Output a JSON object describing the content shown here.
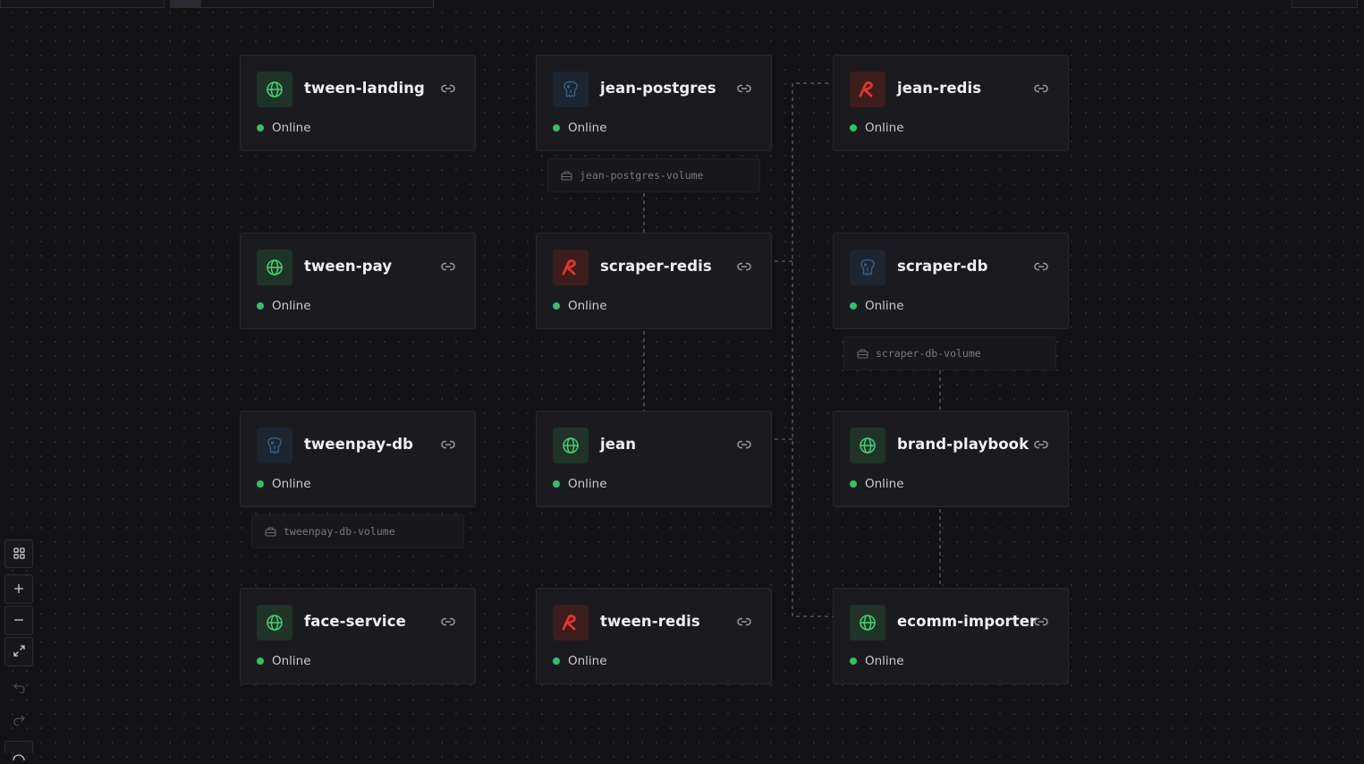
{
  "services": [
    {
      "name": "tween-landing",
      "type": "web",
      "status": "Online"
    },
    {
      "name": "jean-postgres",
      "type": "postgres",
      "status": "Online"
    },
    {
      "name": "jean-redis",
      "type": "redis",
      "status": "Online"
    },
    {
      "name": "tween-pay",
      "type": "web",
      "status": "Online"
    },
    {
      "name": "scraper-redis",
      "type": "redis",
      "status": "Online"
    },
    {
      "name": "scraper-db",
      "type": "postgres",
      "status": "Online"
    },
    {
      "name": "tweenpay-db",
      "type": "postgres",
      "status": "Online"
    },
    {
      "name": "jean",
      "type": "web",
      "status": "Online"
    },
    {
      "name": "brand-playbook",
      "type": "web",
      "status": "Online"
    },
    {
      "name": "face-service",
      "type": "web",
      "status": "Online"
    },
    {
      "name": "tween-redis",
      "type": "redis",
      "status": "Online"
    },
    {
      "name": "ecomm-importer",
      "type": "web",
      "status": "Online"
    }
  ],
  "volumes": [
    {
      "name": "jean-postgres-volume"
    },
    {
      "name": "scraper-db-volume"
    },
    {
      "name": "tweenpay-db-volume"
    }
  ],
  "toolbar": [
    "grid-icon",
    "plus-icon",
    "minus-icon",
    "expand-icon",
    "undo-icon",
    "redo-icon"
  ],
  "colors": {
    "background": "#131316",
    "card": "#1b1b1f",
    "online": "#2ec466",
    "web_icon": "#3ecf6f",
    "redis_icon": "#e5352b",
    "postgres_icon": "#3a5f86"
  }
}
